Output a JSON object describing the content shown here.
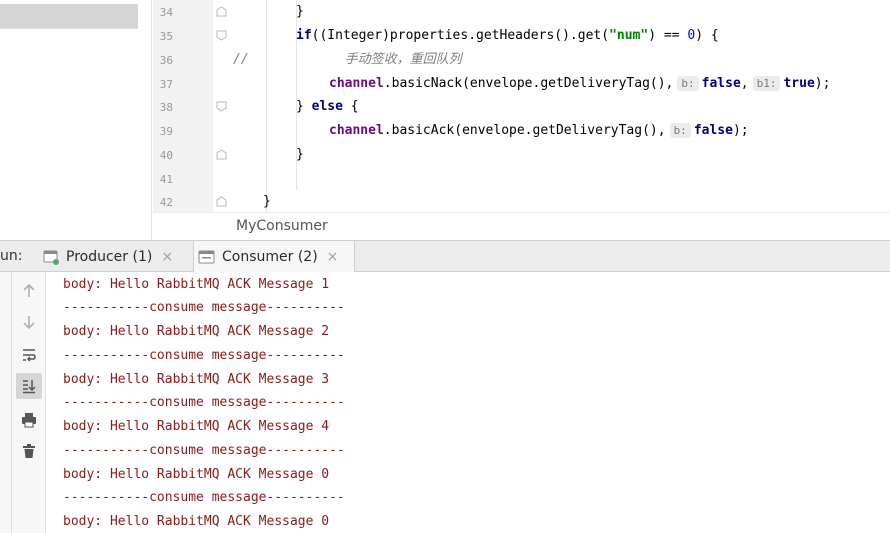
{
  "editor": {
    "line_numbers": [
      "34",
      "35",
      "36",
      "37",
      "38",
      "39",
      "40",
      "41",
      "42"
    ],
    "code": {
      "l34": {
        "brace": "}"
      },
      "l35": {
        "kw_if": "if",
        "p1": "((Integer)properties.getHeaders().get(",
        "str": "\"num\"",
        "p2": ") == ",
        "zero": "0",
        "p3": ") {"
      },
      "l36": {
        "comment_marker": "//",
        "comment_text": "手动签收，重回队列"
      },
      "l37": {
        "field": "channel",
        "call": ".basicNack(envelope.getDeliveryTag(),",
        "hint_b": "b:",
        "val_false": "false",
        "sep": ",",
        "hint_b1": "b1:",
        "val_true": "true",
        "end": ");"
      },
      "l38": {
        "open": "} ",
        "kw_else": "else",
        "close": " {"
      },
      "l39": {
        "field": "channel",
        "call": ".basicAck(envelope.getDeliveryTag(),",
        "hint_b": "b:",
        "val_false": "false",
        "end": ");"
      },
      "l40": {
        "brace": "}"
      },
      "l42": {
        "brace": "}"
      }
    },
    "breadcrumb": "MyConsumer"
  },
  "run_window": {
    "label": "un:",
    "tabs": [
      {
        "label": "Producer (1)",
        "close": "×",
        "icon": "run-config-icon"
      },
      {
        "label": "Consumer (2)",
        "close": "×",
        "icon": "console-icon"
      }
    ],
    "toolbar_icons": [
      "up-arrow-icon",
      "down-arrow-icon",
      "soft-wrap-icon",
      "scroll-to-end-icon",
      "print-icon",
      "trash-icon"
    ],
    "console_lines": [
      "body: Hello RabbitMQ ACK Message 1",
      "-----------consume message----------",
      "body: Hello RabbitMQ ACK Message 2",
      "-----------consume message----------",
      "body: Hello RabbitMQ ACK Message 3",
      "-----------consume message----------",
      "body: Hello RabbitMQ ACK Message 4",
      "-----------consume message----------",
      "body: Hello RabbitMQ ACK Message 0",
      "-----------consume message----------",
      "body: Hello RabbitMQ ACK Message 0"
    ]
  },
  "colors": {
    "keyword": "#000080",
    "field": "#660e7a",
    "string": "#008000",
    "number": "#0000ff",
    "comment": "#808080",
    "console_text": "#8b1a1a"
  }
}
